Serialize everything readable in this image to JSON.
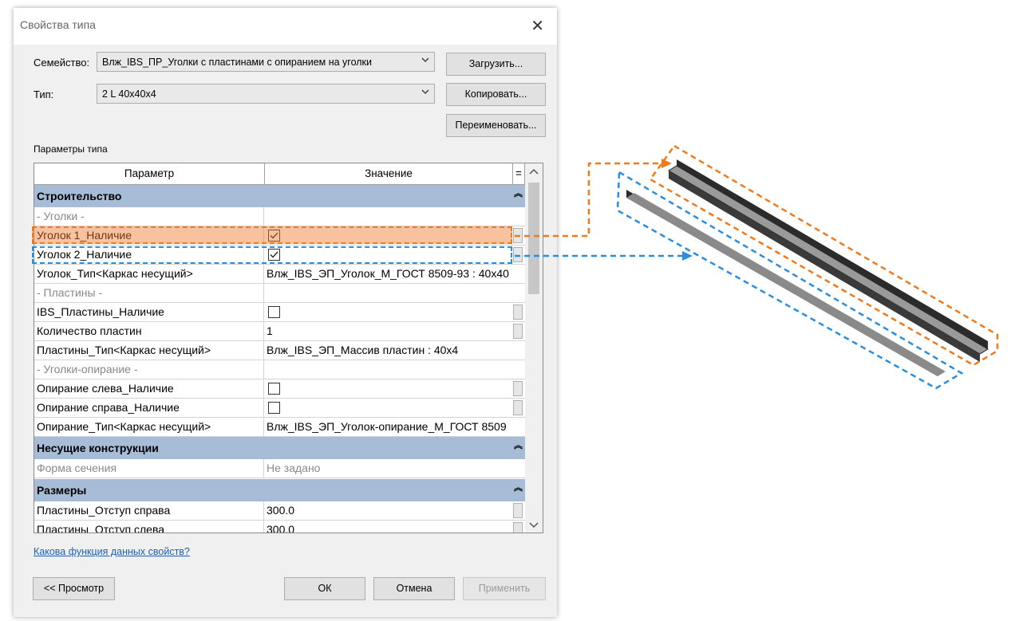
{
  "window": {
    "title": "Свойства типа"
  },
  "family": {
    "label": "Семейство:",
    "value": "Влж_IBS_ПР_Уголки с пластинами с опиранием на уголки"
  },
  "type": {
    "label": "Тип:",
    "value": "2 L 40x40x4"
  },
  "buttons": {
    "load": "Загрузить...",
    "copy": "Копировать...",
    "rename": "Переименовать...",
    "preview": "<< Просмотр",
    "ok": "ОК",
    "cancel": "Отмена",
    "apply": "Применить"
  },
  "params": {
    "section_label": "Параметры типа",
    "col_param": "Параметр",
    "col_value": "Значение",
    "col_eq": "=",
    "groups": [
      {
        "title": "Строительство"
      },
      {
        "title": "Несущие конструкции"
      },
      {
        "title": "Размеры"
      }
    ],
    "rows": [
      {
        "name": "- Уголки -"
      },
      {
        "name": "Уголок 1_Наличие",
        "checked": true
      },
      {
        "name": "Уголок 2_Наличие",
        "checked": true
      },
      {
        "name": "Уголок_Тип<Каркас несущий>",
        "value": "Влж_IBS_ЭП_Уголок_М_ГОСТ 8509-93 : 40x40"
      },
      {
        "name": "- Пластины -"
      },
      {
        "name": "IBS_Пластины_Наличие",
        "checked": false
      },
      {
        "name": "Количество пластин",
        "value": "1"
      },
      {
        "name": "Пластины_Тип<Каркас несущий>",
        "value": "Влж_IBS_ЭП_Массив пластин : 40x4"
      },
      {
        "name": "- Уголки-опирание -"
      },
      {
        "name": "Опирание слева_Наличие",
        "checked": false
      },
      {
        "name": "Опирание справа_Наличие",
        "checked": false
      },
      {
        "name": "Опирание_Тип<Каркас несущий>",
        "value": "Влж_IBS_ЭП_Уголок-опирание_М_ГОСТ 8509"
      },
      {
        "name": "Форма сечения",
        "value": "Не задано"
      },
      {
        "name": "Пластины_Отступ справа",
        "value": "300.0"
      },
      {
        "name": "Пластины_Отступ слева",
        "value": "300.0"
      }
    ]
  },
  "help_link": "Какова функция данных свойств?",
  "colors": {
    "section_header": "#a7bcd6",
    "highlight_orange": "#f07a1a",
    "highlight_blue": "#2a8ee0"
  }
}
